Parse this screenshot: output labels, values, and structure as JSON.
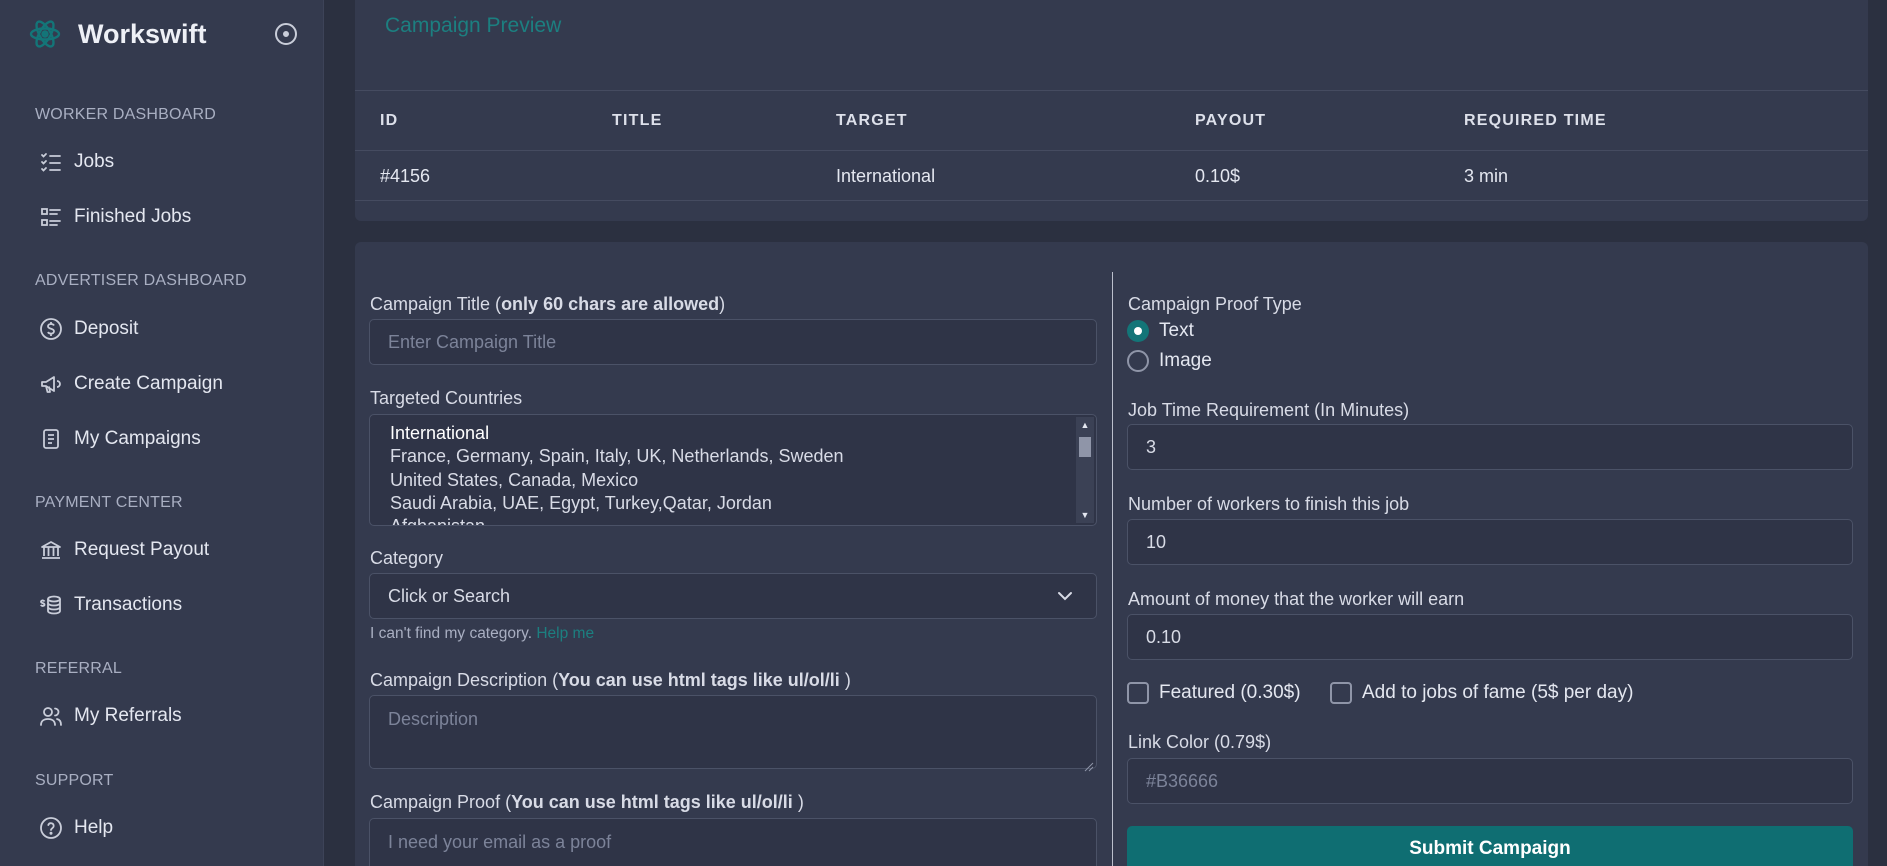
{
  "colors": {
    "accent": "#0f6e72",
    "accent_text": "#1c7f80",
    "background": "#2b3040",
    "surface": "#343a4e"
  },
  "brand": {
    "name": "Workswift",
    "logo_icon": "atom-logo-icon",
    "toggle_icon": "circle-dot-icon"
  },
  "sidebar": {
    "sections": [
      {
        "title": "WORKER DASHBOARD"
      },
      {
        "title": "ADVERTISER DASHBOARD"
      },
      {
        "title": "PAYMENT CENTER"
      },
      {
        "title": "REFERRAL"
      },
      {
        "title": "SUPPORT"
      }
    ],
    "items": [
      {
        "label": "Jobs",
        "icon": "checklist-icon"
      },
      {
        "label": "Finished Jobs",
        "icon": "list-icon"
      },
      {
        "label": "Deposit",
        "icon": "dollar-circle-icon"
      },
      {
        "label": "Create Campaign",
        "icon": "megaphone-icon"
      },
      {
        "label": "My Campaigns",
        "icon": "document-icon"
      },
      {
        "label": "Request Payout",
        "icon": "bank-icon"
      },
      {
        "label": "Transactions",
        "icon": "coins-icon"
      },
      {
        "label": "My Referrals",
        "icon": "users-icon"
      },
      {
        "label": "Help",
        "icon": "help-circle-icon"
      }
    ]
  },
  "preview": {
    "title": "Campaign Preview",
    "columns": [
      "ID",
      "TITLE",
      "TARGET",
      "PAYOUT",
      "REQUIRED TIME"
    ],
    "row": {
      "id": "#4156",
      "title": "",
      "target": "International",
      "payout": "0.10$",
      "time": "3 min"
    }
  },
  "form": {
    "title_label": "Campaign Title (",
    "title_label_bold": "only 60 chars are allowed",
    "title_label_end": ")",
    "title_placeholder": "Enter Campaign Title",
    "countries_label": "Targeted Countries",
    "countries": [
      "International",
      "France, Germany, Spain, Italy, UK, Netherlands, Sweden",
      "United States, Canada, Mexico",
      "Saudi Arabia, UAE, Egypt, Turkey,Qatar, Jordan",
      "Afghanistan"
    ],
    "category_label": "Category",
    "category_value": "Click or Search",
    "category_hint": "I can't find my category.",
    "category_hint_link": "Help me",
    "description_label": "Campaign Description (",
    "description_label_bold": "You can use html tags like ul/ol/li",
    "description_label_end": " )",
    "description_placeholder": "Description",
    "proof_label": "Campaign Proof (",
    "proof_label_bold": "You can use html tags like ul/ol/li",
    "proof_label_end": " )",
    "proof_placeholder": "I need your email as a proof",
    "proof_type_label": "Campaign Proof Type",
    "proof_type_text": "Text",
    "proof_type_image": "Image",
    "time_label": "Job Time Requirement (In Minutes)",
    "time_value": "3",
    "workers_label": "Number of workers to finish this job",
    "workers_value": "10",
    "money_label": "Amount of money that the worker will earn",
    "money_value": "0.10",
    "featured_label": "Featured (0.30$)",
    "fame_label": "Add to jobs of fame (5$ per day)",
    "link_color_label": "Link Color (0.79$)",
    "link_color_placeholder": "#B36666",
    "submit_label": "Submit Campaign"
  }
}
